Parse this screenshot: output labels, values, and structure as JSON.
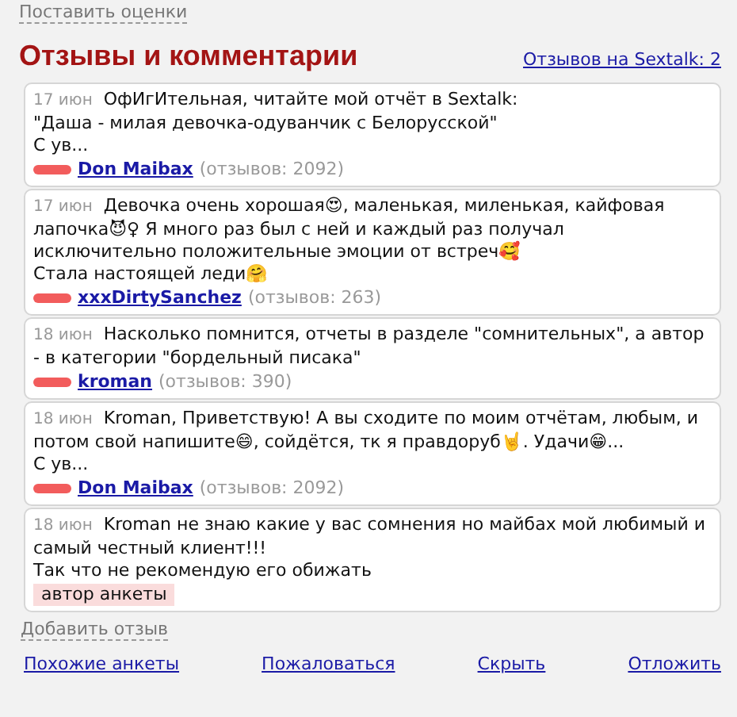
{
  "rate_link": "Поставить оценки",
  "heading": "Отзывы и комментарии",
  "count_link": "Отзывов на Sextalk: 2",
  "reviews": [
    {
      "date": "17 июн",
      "text": "ОфИгИтельная, читайте мой отчёт в Sextalk:\n\"Даша - милая девочка-одуванчик с Белорусской\"\nС ув...",
      "author": {
        "kind": "user",
        "name": "Don Maibax",
        "count": "(отзывов: 2092)"
      }
    },
    {
      "date": "17 июн",
      "text": "Девочка очень хорошая😍, маленькая, миленькая, кайфовая лапочка😈♀ Я много раз был с ней и каждый раз получал исключительно положительные эмоции от встреч🥰\nСтала настоящей леди🤗",
      "author": {
        "kind": "user",
        "name": "xxxDirtySanchez",
        "count": "(отзывов: 263)"
      }
    },
    {
      "date": "18 июн",
      "text": "Насколько помнится, отчеты в разделе \"сомнительных\", а автор - в категории \"бордельный писака\"",
      "author": {
        "kind": "user",
        "name": "kroman",
        "count": "(отзывов: 390)"
      }
    },
    {
      "date": "18 июн",
      "text": "Kroman, Приветствую! А вы сходите по моим отчётам, любым, и потом свой напишите😄, сойдётся, тк я правдоруб🤘. Удачи😁...\nС ув...",
      "author": {
        "kind": "user",
        "name": "Don Maibax",
        "count": "(отзывов: 2092)"
      }
    },
    {
      "date": "18 июн",
      "text": "Kroman не знаю какие у вас сомнения но майбах мой любимый и самый честный клиент!!!\nТак что не рекомендую его обижать",
      "author": {
        "kind": "owner",
        "label": "автор анкеты"
      }
    }
  ],
  "add_link": "Добавить отзыв",
  "footer_links": [
    "Похожие анкеты",
    "Пожаловаться",
    "Скрыть",
    "Отложить"
  ]
}
